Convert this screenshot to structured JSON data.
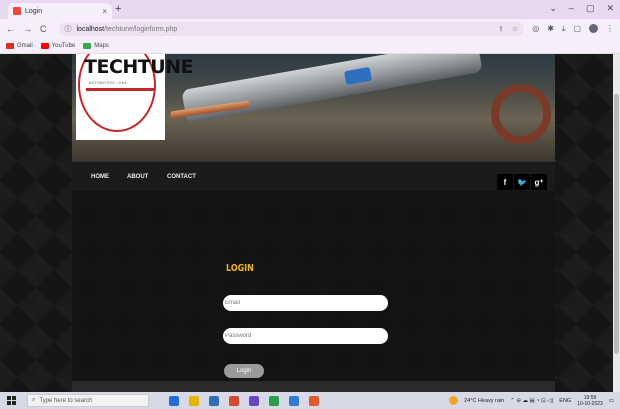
{
  "browser": {
    "tab_title": "Login",
    "tab_close": "×",
    "new_tab": "+",
    "window_controls": [
      "⌄",
      "–",
      "▢",
      "✕"
    ],
    "url_host": "localhost",
    "url_path": "/techtune/loginform.php",
    "bookmarks": [
      {
        "label": "Gmail",
        "color": "#d93025"
      },
      {
        "label": "YouTube",
        "color": "#ff0000"
      },
      {
        "label": "Maps",
        "color": "#34a853"
      }
    ]
  },
  "site": {
    "logo_word": "TECHTUNE",
    "logo_tagline": "AUTOMOTIVE • KKA",
    "nav": {
      "home": "HOME",
      "about": "ABOUT",
      "contact": "CONTACT"
    },
    "social": {
      "facebook": "f",
      "twitter": "🐦",
      "googleplus": "g⁺"
    },
    "login": {
      "title": "LOGIN",
      "email_placeholder": "Email",
      "password_placeholder": "Password",
      "button_label": "Login"
    },
    "accent": "#f0b419"
  },
  "taskbar": {
    "search_placeholder": "Type here to search",
    "weather": "24°C Heavy rain",
    "lang": "ENG",
    "time": "19:59",
    "date": "10-10-2023"
  }
}
